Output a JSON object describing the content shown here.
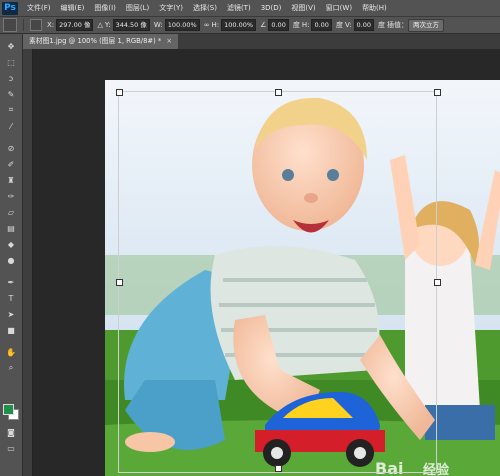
{
  "app": {
    "logo": "Ps"
  },
  "menu": [
    "文件(F)",
    "编辑(E)",
    "图像(I)",
    "图层(L)",
    "文字(Y)",
    "选择(S)",
    "滤镜(T)",
    "3D(D)",
    "视图(V)",
    "窗口(W)",
    "帮助(H)"
  ],
  "options": {
    "x_label": "X:",
    "x_value": "297.00 像",
    "delta": "△",
    "y_label": "Y:",
    "y_value": "344.50 像",
    "w_label": "W:",
    "w_value": "100.00%",
    "link_icon": "∞",
    "h_label": "H:",
    "h_value": "100.00%",
    "rot_icon": "∠",
    "rot_value": "0.00",
    "rot_unit": "度",
    "hskew_label": "H:",
    "hskew_value": "0.00",
    "hskew_unit": "度",
    "vskew_label": "V:",
    "vskew_value": "0.00",
    "vskew_unit": "度",
    "interp_label": "插值：",
    "interp_value": "两次立方"
  },
  "document": {
    "tab_title": "素材图1.jpg @ 100% (图层 1, RGB/8#) *",
    "close": "×"
  },
  "colors": {
    "foreground": "#1f8f4c",
    "background": "#ffffff"
  },
  "watermark": {
    "text": "Bai",
    "text2": "经验"
  },
  "tools": [
    "move-icon",
    "marquee-icon",
    "lasso-icon",
    "quick-select-icon",
    "crop-icon",
    "eyedropper-icon",
    "healing-icon",
    "brush-icon",
    "stamp-icon",
    "history-brush-icon",
    "eraser-icon",
    "gradient-icon",
    "blur-icon",
    "dodge-icon",
    "pen-icon",
    "type-icon",
    "path-select-icon",
    "shape-icon",
    "hand-icon",
    "zoom-icon"
  ]
}
